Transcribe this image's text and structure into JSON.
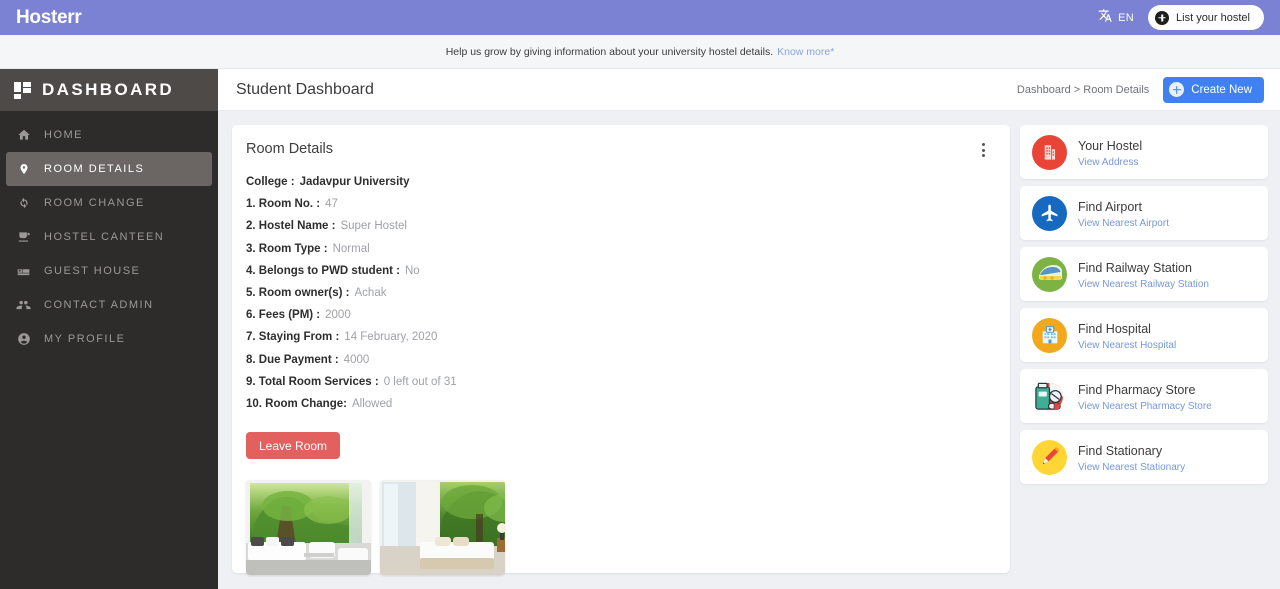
{
  "topbar": {
    "brand": "Hosterr",
    "lang_code": "EN",
    "lang_icon": "translate-icon",
    "list_hostel_label": "List your hostel",
    "purple": "#7b82d4"
  },
  "banner": {
    "text": "Help us grow by giving information about your university hostel details.",
    "link": "Know more*"
  },
  "sidebar": {
    "title": "DASHBOARD",
    "logo_icon": "grid-icon",
    "bg": "#2d2c2b",
    "active_bg": "#6b6663",
    "items": [
      {
        "label": "HOME",
        "icon": "home-icon",
        "active": false
      },
      {
        "label": "ROOM DETAILS",
        "icon": "location-pin-icon",
        "active": true
      },
      {
        "label": "ROOM CHANGE",
        "icon": "sync-icon",
        "active": false
      },
      {
        "label": "HOSTEL CANTEEN",
        "icon": "canteen-icon",
        "active": false
      },
      {
        "label": "GUEST HOUSE",
        "icon": "bed-icon",
        "active": false
      },
      {
        "label": "CONTACT ADMIN",
        "icon": "people-icon",
        "active": false
      },
      {
        "label": "MY PROFILE",
        "icon": "account-circle-icon",
        "active": false
      }
    ]
  },
  "header": {
    "page_title": "Student Dashboard",
    "breadcrumb": "Dashboard > Room Details",
    "create_label": "Create New",
    "create_color": "#3f81f0"
  },
  "card": {
    "title": "Room Details",
    "menu_icon": "kebab-menu-icon",
    "college_key": "College :",
    "college_value": "Jadavpur University",
    "rows": [
      {
        "key": "1. Room No. :",
        "value": "47"
      },
      {
        "key": "2. Hostel Name :",
        "value": "Super Hostel"
      },
      {
        "key": "3. Room Type :",
        "value": "Normal"
      },
      {
        "key": "4. Belongs to PWD student :",
        "value": "No"
      },
      {
        "key": "5. Room owner(s) :",
        "value": "Achak"
      },
      {
        "key": "6. Fees (PM) :",
        "value": "2000"
      },
      {
        "key": "7. Staying From :",
        "value": "14 February, 2020"
      },
      {
        "key": "8. Due Payment :",
        "value": "4000"
      },
      {
        "key": "9. Total Room Services :",
        "value": "0 left out of 31"
      },
      {
        "key": "10. Room Change:",
        "value": "Allowed"
      }
    ],
    "leave_label": "Leave Room",
    "leave_color": "#e2605e",
    "photos": [
      {
        "name": "room-photo-living-room"
      },
      {
        "name": "room-photo-bedroom"
      }
    ]
  },
  "rail": {
    "cards": [
      {
        "title": "Your Hostel",
        "link": "View Address",
        "icon": "building-icon",
        "color": "#ea4436"
      },
      {
        "title": "Find Airport",
        "link": "View Nearest Airport",
        "icon": "airplane-icon",
        "color": "#1769c0"
      },
      {
        "title": "Find Railway Station",
        "link": "View Nearest Railway Station",
        "icon": "train-icon",
        "color": "#7cb342"
      },
      {
        "title": "Find Hospital",
        "link": "View Nearest Hospital",
        "icon": "hospital-icon",
        "color": "#f2a81d"
      },
      {
        "title": "Find Pharmacy Store",
        "link": "View Nearest Pharmacy Store",
        "icon": "medicine-icon",
        "color": "#ffffff"
      },
      {
        "title": "Find Stationary",
        "link": "View Nearest Stationary",
        "icon": "pencil-icon",
        "color": "#ffd633"
      }
    ]
  }
}
